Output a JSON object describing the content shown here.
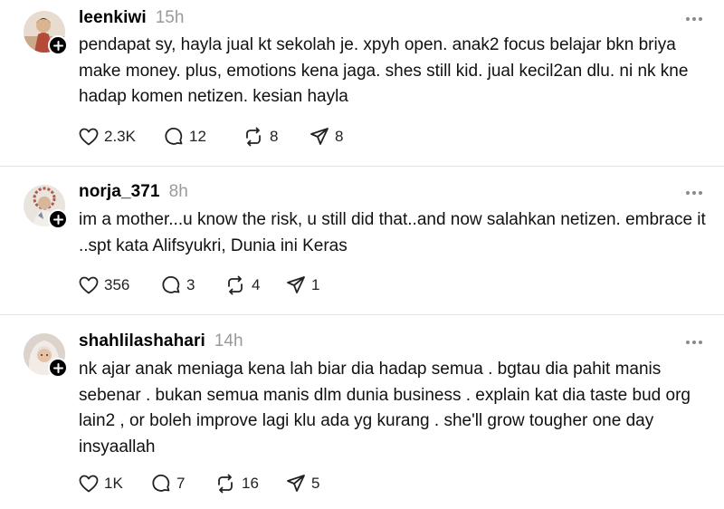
{
  "posts": [
    {
      "username": "leenkiwi",
      "time": "15h",
      "text": "pendapat sy, hayla jual kt sekolah je. xpyh open. anak2 focus belajar bkn briya make money. plus, emotions kena jaga. shes still kid. jual kecil2an dlu. ni nk kne hadap komen netizen. kesian hayla",
      "likes": "2.3K",
      "replies": "12",
      "reposts": "8",
      "shares": "8"
    },
    {
      "username": "norja_371",
      "time": "8h",
      "text": "im a mother...u know the risk, u still did that..and now salahkan netizen. embrace it ..spt kata Alifsyukri, Dunia ini Keras",
      "likes": "356",
      "replies": "3",
      "reposts": "4",
      "shares": "1"
    },
    {
      "username": "shahlilashahari",
      "time": "14h",
      "text": "nk ajar anak meniaga kena lah biar dia hadap semua . bgtau dia pahit manis sebenar . bukan semua manis dlm dunia business . explain kat dia taste bud org lain2 , or boleh improve lagi klu ada yg kurang . she'll grow tougher one day insyaallah",
      "likes": "1K",
      "replies": "7",
      "reposts": "16",
      "shares": "5"
    }
  ],
  "icons": {
    "like": "heart-icon",
    "reply": "comment-bubble-icon",
    "repost": "repost-arrows-icon",
    "share": "send-paper-plane-icon",
    "more": "more-horizontal-icon",
    "follow": "plus-icon"
  },
  "colors": {
    "text": "#000000",
    "muted": "#9a9a9a",
    "divider": "#e3e3e3",
    "badge": "#000000"
  }
}
